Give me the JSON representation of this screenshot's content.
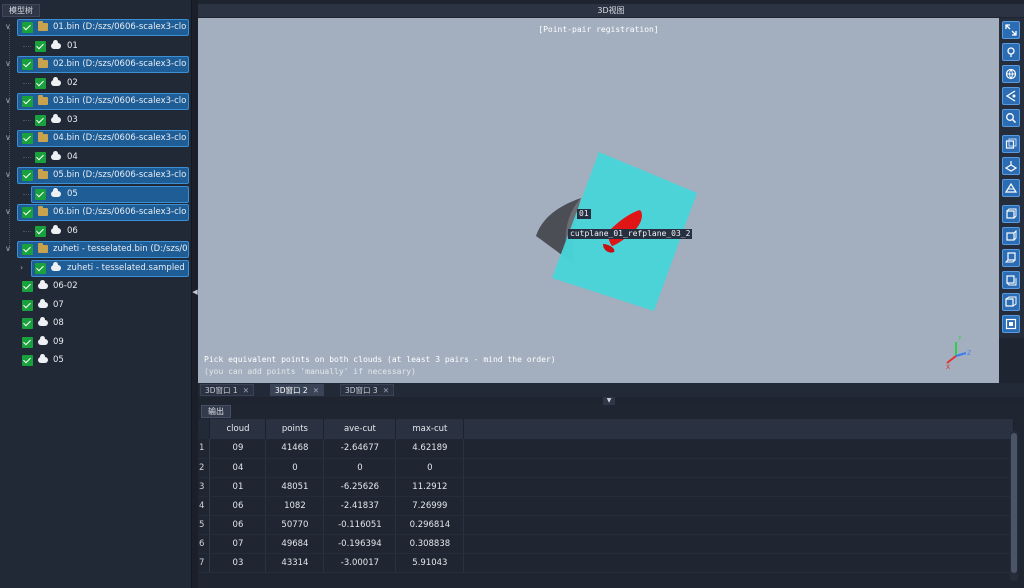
{
  "tree": {
    "tab_label": "模型树",
    "items": [
      {
        "label": "01.bin (D:/szs/0606-scalex3-clo...",
        "kind": "folder"
      },
      {
        "label": "01",
        "kind": "cloud"
      },
      {
        "label": "02.bin (D:/szs/0606-scalex3-clo...",
        "kind": "folder"
      },
      {
        "label": "02",
        "kind": "cloud"
      },
      {
        "label": "03.bin (D:/szs/0606-scalex3-clo...",
        "kind": "folder"
      },
      {
        "label": "03",
        "kind": "cloud"
      },
      {
        "label": "04.bin (D:/szs/0606-scalex3-clo...",
        "kind": "folder"
      },
      {
        "label": "04",
        "kind": "cloud"
      },
      {
        "label": "05.bin (D:/szs/0606-scalex3-clo...",
        "kind": "folder"
      },
      {
        "label": "05",
        "kind": "cloud"
      },
      {
        "label": "06.bin (D:/szs/0606-scalex3-clo...",
        "kind": "folder"
      },
      {
        "label": "06",
        "kind": "cloud"
      },
      {
        "label": "zuheti - tesselated.bin (D:/szs/0...",
        "kind": "folder"
      },
      {
        "label": "zuheti - tesselated.sampled",
        "kind": "cloud"
      },
      {
        "label": "06-02",
        "kind": "cloud"
      },
      {
        "label": "07",
        "kind": "cloud"
      },
      {
        "label": "08",
        "kind": "cloud"
      },
      {
        "label": "09",
        "kind": "cloud"
      },
      {
        "label": "05",
        "kind": "cloud"
      }
    ]
  },
  "view": {
    "header": "3D视图",
    "title": "[Point-pair registration]",
    "message_line1": "Pick equivalent points on both clouds (at least 3 pairs - mind the order)",
    "message_line2": "(you can add points 'manually' if necessary)",
    "tag_point": "01",
    "tag_plane": "cutplane_01_refplane_03_2",
    "axis_labels": {
      "x": "X",
      "y": "Y",
      "z": "Z"
    },
    "colors": {
      "background": "#a3afbf",
      "plane": "#48d4d9",
      "red_object": "#e01515",
      "toolbar_button": "#2c6cb3"
    }
  },
  "toolbar_icons": [
    "fullscreen-icon",
    "pin-icon",
    "globe-icon",
    "pick-icon",
    "zoom-icon",
    "front-view-icon",
    "iso-view-icon",
    "left-view-icon",
    "top-view-icon",
    "right-view-icon",
    "back-view-icon",
    "bottom-view-icon",
    "iso2-view-icon",
    "frame-view-icon"
  ],
  "view_tabs": [
    {
      "label": "3D窗口 1",
      "active": false
    },
    {
      "label": "3D窗口 2",
      "active": true
    },
    {
      "label": "3D窗口 3",
      "active": false
    }
  ],
  "output": {
    "tab_label": "输出",
    "columns": [
      "cloud",
      "points",
      "ave-cut",
      "max-cut"
    ],
    "rows": [
      {
        "n": "1",
        "cloud": "09",
        "points": "41468",
        "ave": "-2.64677",
        "max": "4.62189"
      },
      {
        "n": "2",
        "cloud": "04",
        "points": "0",
        "ave": "0",
        "max": "0"
      },
      {
        "n": "3",
        "cloud": "01",
        "points": "48051",
        "ave": "-6.25626",
        "max": "11.2912"
      },
      {
        "n": "4",
        "cloud": "06",
        "points": "1082",
        "ave": "-2.41837",
        "max": "7.26999"
      },
      {
        "n": "5",
        "cloud": "06",
        "points": "50770",
        "ave": "-0.116051",
        "max": "0.296814"
      },
      {
        "n": "6",
        "cloud": "07",
        "points": "49684",
        "ave": "-0.196394",
        "max": "0.308838"
      },
      {
        "n": "7",
        "cloud": "03",
        "points": "43314",
        "ave": "-3.00017",
        "max": "5.91043"
      }
    ]
  }
}
